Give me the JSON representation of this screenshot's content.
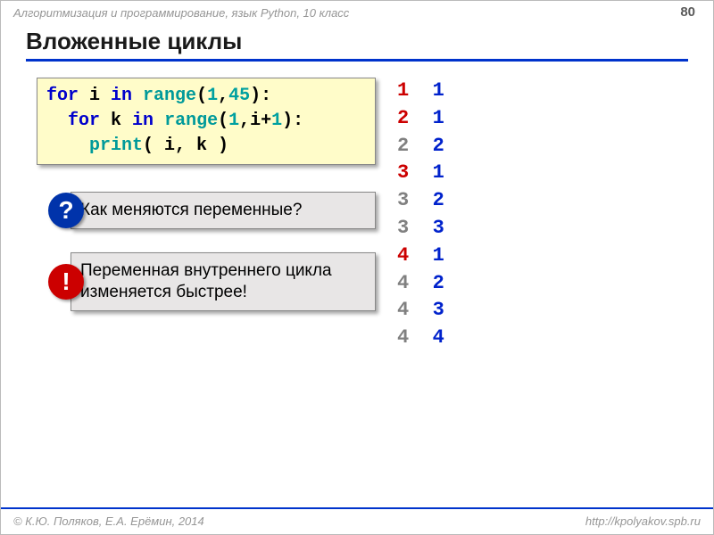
{
  "header": {
    "breadcrumb": "Алгоритмизация и программирование, язык Python, 10 класс",
    "page_number": "80"
  },
  "title": "Вложенные циклы",
  "code": {
    "l1": {
      "for": "for",
      "i": " i ",
      "in": "in",
      "range": " range",
      "p1": "(",
      "n1": "1",
      "c1": ",",
      "n2": "45",
      "p2": "):"
    },
    "l2": {
      "indent": "  ",
      "for": "for",
      "k": " k ",
      "in": "in",
      "range": " range",
      "p1": "(",
      "n1": "1",
      "c1": ",i+",
      "n2": "1",
      "p2": "):"
    },
    "l3": {
      "indent": "    ",
      "print": "print",
      "body": "( i, k )"
    }
  },
  "question": {
    "badge": "?",
    "text": "Как меняются переменные?"
  },
  "exclaim": {
    "badge": "!",
    "text": "Переменная внутреннего цикла изменяется быстрее!"
  },
  "output": [
    {
      "i": {
        "val": "1",
        "first": true
      },
      "k": {
        "val": "1",
        "first": true
      }
    },
    {
      "i": {
        "val": "2",
        "first": true
      },
      "k": {
        "val": "1",
        "first": true
      }
    },
    {
      "i": {
        "val": "2",
        "first": false
      },
      "k": {
        "val": "2",
        "first": false
      }
    },
    {
      "i": {
        "val": "3",
        "first": true
      },
      "k": {
        "val": "1",
        "first": true
      }
    },
    {
      "i": {
        "val": "3",
        "first": false
      },
      "k": {
        "val": "2",
        "first": false
      }
    },
    {
      "i": {
        "val": "3",
        "first": false
      },
      "k": {
        "val": "3",
        "first": false
      }
    },
    {
      "i": {
        "val": "4",
        "first": true
      },
      "k": {
        "val": "1",
        "first": true
      }
    },
    {
      "i": {
        "val": "4",
        "first": false
      },
      "k": {
        "val": "2",
        "first": false
      }
    },
    {
      "i": {
        "val": "4",
        "first": false
      },
      "k": {
        "val": "3",
        "first": false
      }
    },
    {
      "i": {
        "val": "4",
        "first": false
      },
      "k": {
        "val": "4",
        "first": false
      }
    }
  ],
  "footer": {
    "left": "© К.Ю. Поляков, Е.А. Ерёмин, 2014",
    "right": "http://kpolyakov.spb.ru"
  }
}
